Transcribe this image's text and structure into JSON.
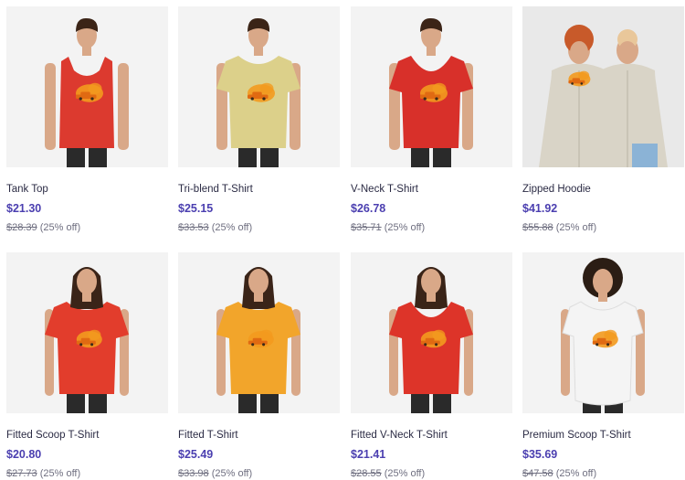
{
  "products": [
    {
      "title": "Tank Top",
      "price": "$21.30",
      "original_price": "$28.39",
      "discount": "(25% off)",
      "model": "man",
      "garment": "tank",
      "garment_color": "#dc3a2f",
      "thumb_bg": "#f3f3f3"
    },
    {
      "title": "Tri-blend T-Shirt",
      "price": "$25.15",
      "original_price": "$33.53",
      "discount": "(25% off)",
      "model": "man",
      "garment": "tee",
      "garment_color": "#dcd08a",
      "thumb_bg": "#f3f3f3"
    },
    {
      "title": "V-Neck T-Shirt",
      "price": "$26.78",
      "original_price": "$35.71",
      "discount": "(25% off)",
      "model": "man",
      "garment": "vneck",
      "garment_color": "#d8302a",
      "thumb_bg": "#f3f3f3"
    },
    {
      "title": "Zipped Hoodie",
      "price": "$41.92",
      "original_price": "$55.88",
      "discount": "(25% off)",
      "model": "couple",
      "garment": "hoodie",
      "garment_color": "#d9d4c7",
      "thumb_bg": "#e9e9e9"
    },
    {
      "title": "Fitted Scoop T-Shirt",
      "price": "$20.80",
      "original_price": "$27.73",
      "discount": "(25% off)",
      "model": "woman",
      "garment": "scoop",
      "garment_color": "#e23d2c",
      "thumb_bg": "#f3f3f3"
    },
    {
      "title": "Fitted T-Shirt",
      "price": "$25.49",
      "original_price": "$33.98",
      "discount": "(25% off)",
      "model": "woman",
      "garment": "fitted",
      "garment_color": "#f2a52b",
      "thumb_bg": "#f3f3f3"
    },
    {
      "title": "Fitted V-Neck T-Shirt",
      "price": "$21.41",
      "original_price": "$28.55",
      "discount": "(25% off)",
      "model": "woman",
      "garment": "vneck-w",
      "garment_color": "#dd3429",
      "thumb_bg": "#f3f3f3"
    },
    {
      "title": "Premium Scoop T-Shirt",
      "price": "$35.69",
      "original_price": "$47.58",
      "discount": "(25% off)",
      "model": "woman-curly",
      "garment": "premium",
      "garment_color": "#f4f4f4",
      "thumb_bg": "#f3f3f3"
    }
  ],
  "colors": {
    "price": "#4b3fb0",
    "title": "#2b2b44",
    "muted": "#6f6f80",
    "print_orange": "#f39a1e",
    "print_car": "#e06a12"
  },
  "icons": [
    "product-image"
  ]
}
